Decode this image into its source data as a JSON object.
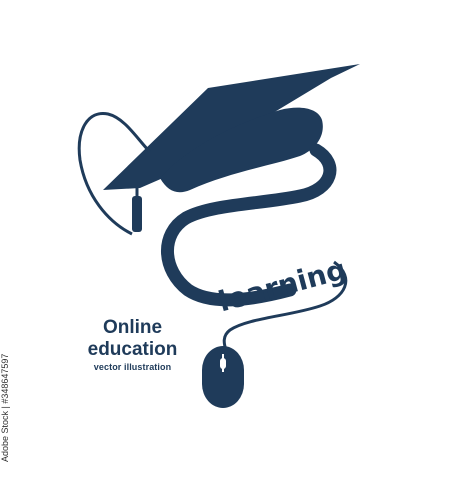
{
  "logo": {
    "word": "learning",
    "caption_line1": "Online",
    "caption_line2": "education",
    "caption_line3": "vector illustration",
    "stock_id": "Adobe Stock | #348647597",
    "watermark": "Adobe Stock"
  },
  "colors": {
    "primary": "#1f3b5a",
    "background": "#ffffff"
  },
  "icons": {
    "cap": "graduation-cap-icon",
    "mouse": "computer-mouse-icon"
  }
}
